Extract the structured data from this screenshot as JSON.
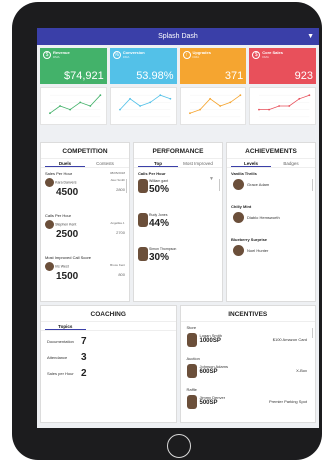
{
  "app": {
    "title": "Splash Dash",
    "menu_icon": "chevron-down-icon"
  },
  "kpis": [
    {
      "name": "Revenue",
      "sub": "DMA",
      "value": "$74,921",
      "color": "#43b26a",
      "icon": "dollar-icon",
      "icon_glyph": "$"
    },
    {
      "name": "Conversion",
      "sub": "DMA",
      "value": "53.98%",
      "color": "#53c1e8",
      "icon": "percent-icon",
      "icon_glyph": "%"
    },
    {
      "name": "Upgrades",
      "sub": "DMA",
      "value": "371",
      "color": "#f5a530",
      "icon": "upgrade-icon",
      "icon_glyph": "↑"
    },
    {
      "name": "Core Sales",
      "sub": "DMA",
      "value": "923",
      "color": "#e8505b",
      "icon": "sales-icon",
      "icon_glyph": "$"
    }
  ],
  "chart_data": [
    {
      "type": "line",
      "color": "#43b26a",
      "values": [
        1,
        3,
        2,
        4,
        3,
        6
      ]
    },
    {
      "type": "line",
      "color": "#53c1e8",
      "values": [
        2,
        5,
        3,
        4,
        6,
        5
      ]
    },
    {
      "type": "line",
      "color": "#f5a530",
      "values": [
        1,
        2,
        5,
        3,
        4,
        6
      ]
    },
    {
      "type": "line",
      "color": "#e8505b",
      "values": [
        2,
        2,
        3,
        3,
        5,
        6
      ]
    }
  ],
  "competition": {
    "title": "COMPETITION",
    "tabs": [
      "Duels",
      "Contests"
    ],
    "active_tab": 0,
    "items": [
      {
        "title": "Sales Per Hour",
        "name": "Kara Danvers",
        "score": "4500",
        "opponent": "Alex Smith",
        "opp_score": "2800",
        "date": "08/05/2018"
      },
      {
        "title": "Calls Per Hour",
        "name": "Stephen Kent",
        "score": "2500",
        "opponent": "Angelika J.",
        "opp_score": "2700",
        "date": ""
      },
      {
        "title": "Most Improved Call Score",
        "name": "Iris West",
        "score": "1500",
        "opponent": "Bruce Kent",
        "opp_score": "800",
        "date": ""
      }
    ]
  },
  "performance": {
    "title": "PERFORMANCE",
    "tabs": [
      "Top",
      "Most Improved"
    ],
    "active_tab": 0,
    "items": [
      {
        "title": "Calls Per Hour",
        "name": "William gant",
        "pct": "50%"
      },
      {
        "title": "",
        "name": "Rudy Jones",
        "pct": "44%"
      },
      {
        "title": "",
        "name": "Simon Thompson",
        "pct": "30%"
      }
    ]
  },
  "achievements": {
    "title": "ACHIEVEMENTS",
    "tabs": [
      "Levels",
      "Badges"
    ],
    "active_tab": 0,
    "items": [
      {
        "title": "Vanilla Thrills",
        "name": "Grace Adam"
      },
      {
        "title": "Chilly Mint",
        "name": "Diablo Hemsworth"
      },
      {
        "title": "Blueberry Surprise",
        "name": "Noel Hunter"
      }
    ]
  },
  "coaching": {
    "title": "COACHING",
    "tab": "Topics",
    "rows": [
      {
        "label": "Documentation",
        "count": "7"
      },
      {
        "label": "Attendance",
        "count": "3"
      },
      {
        "label": "Sales per Hour",
        "count": "2"
      }
    ]
  },
  "incentives": {
    "title": "INCENTIVES",
    "items": [
      {
        "category": "Store",
        "name": "Logan Smith",
        "sp": "1000SP",
        "prize": "$100 Amazon Card"
      },
      {
        "category": "Auction",
        "name": "Johnson Adams",
        "sp": "600SP",
        "prize": "X-Box"
      },
      {
        "category": "Raffle",
        "name": "Jimmy Denver",
        "sp": "500SP",
        "prize": "Premier Parking Spot"
      }
    ]
  }
}
